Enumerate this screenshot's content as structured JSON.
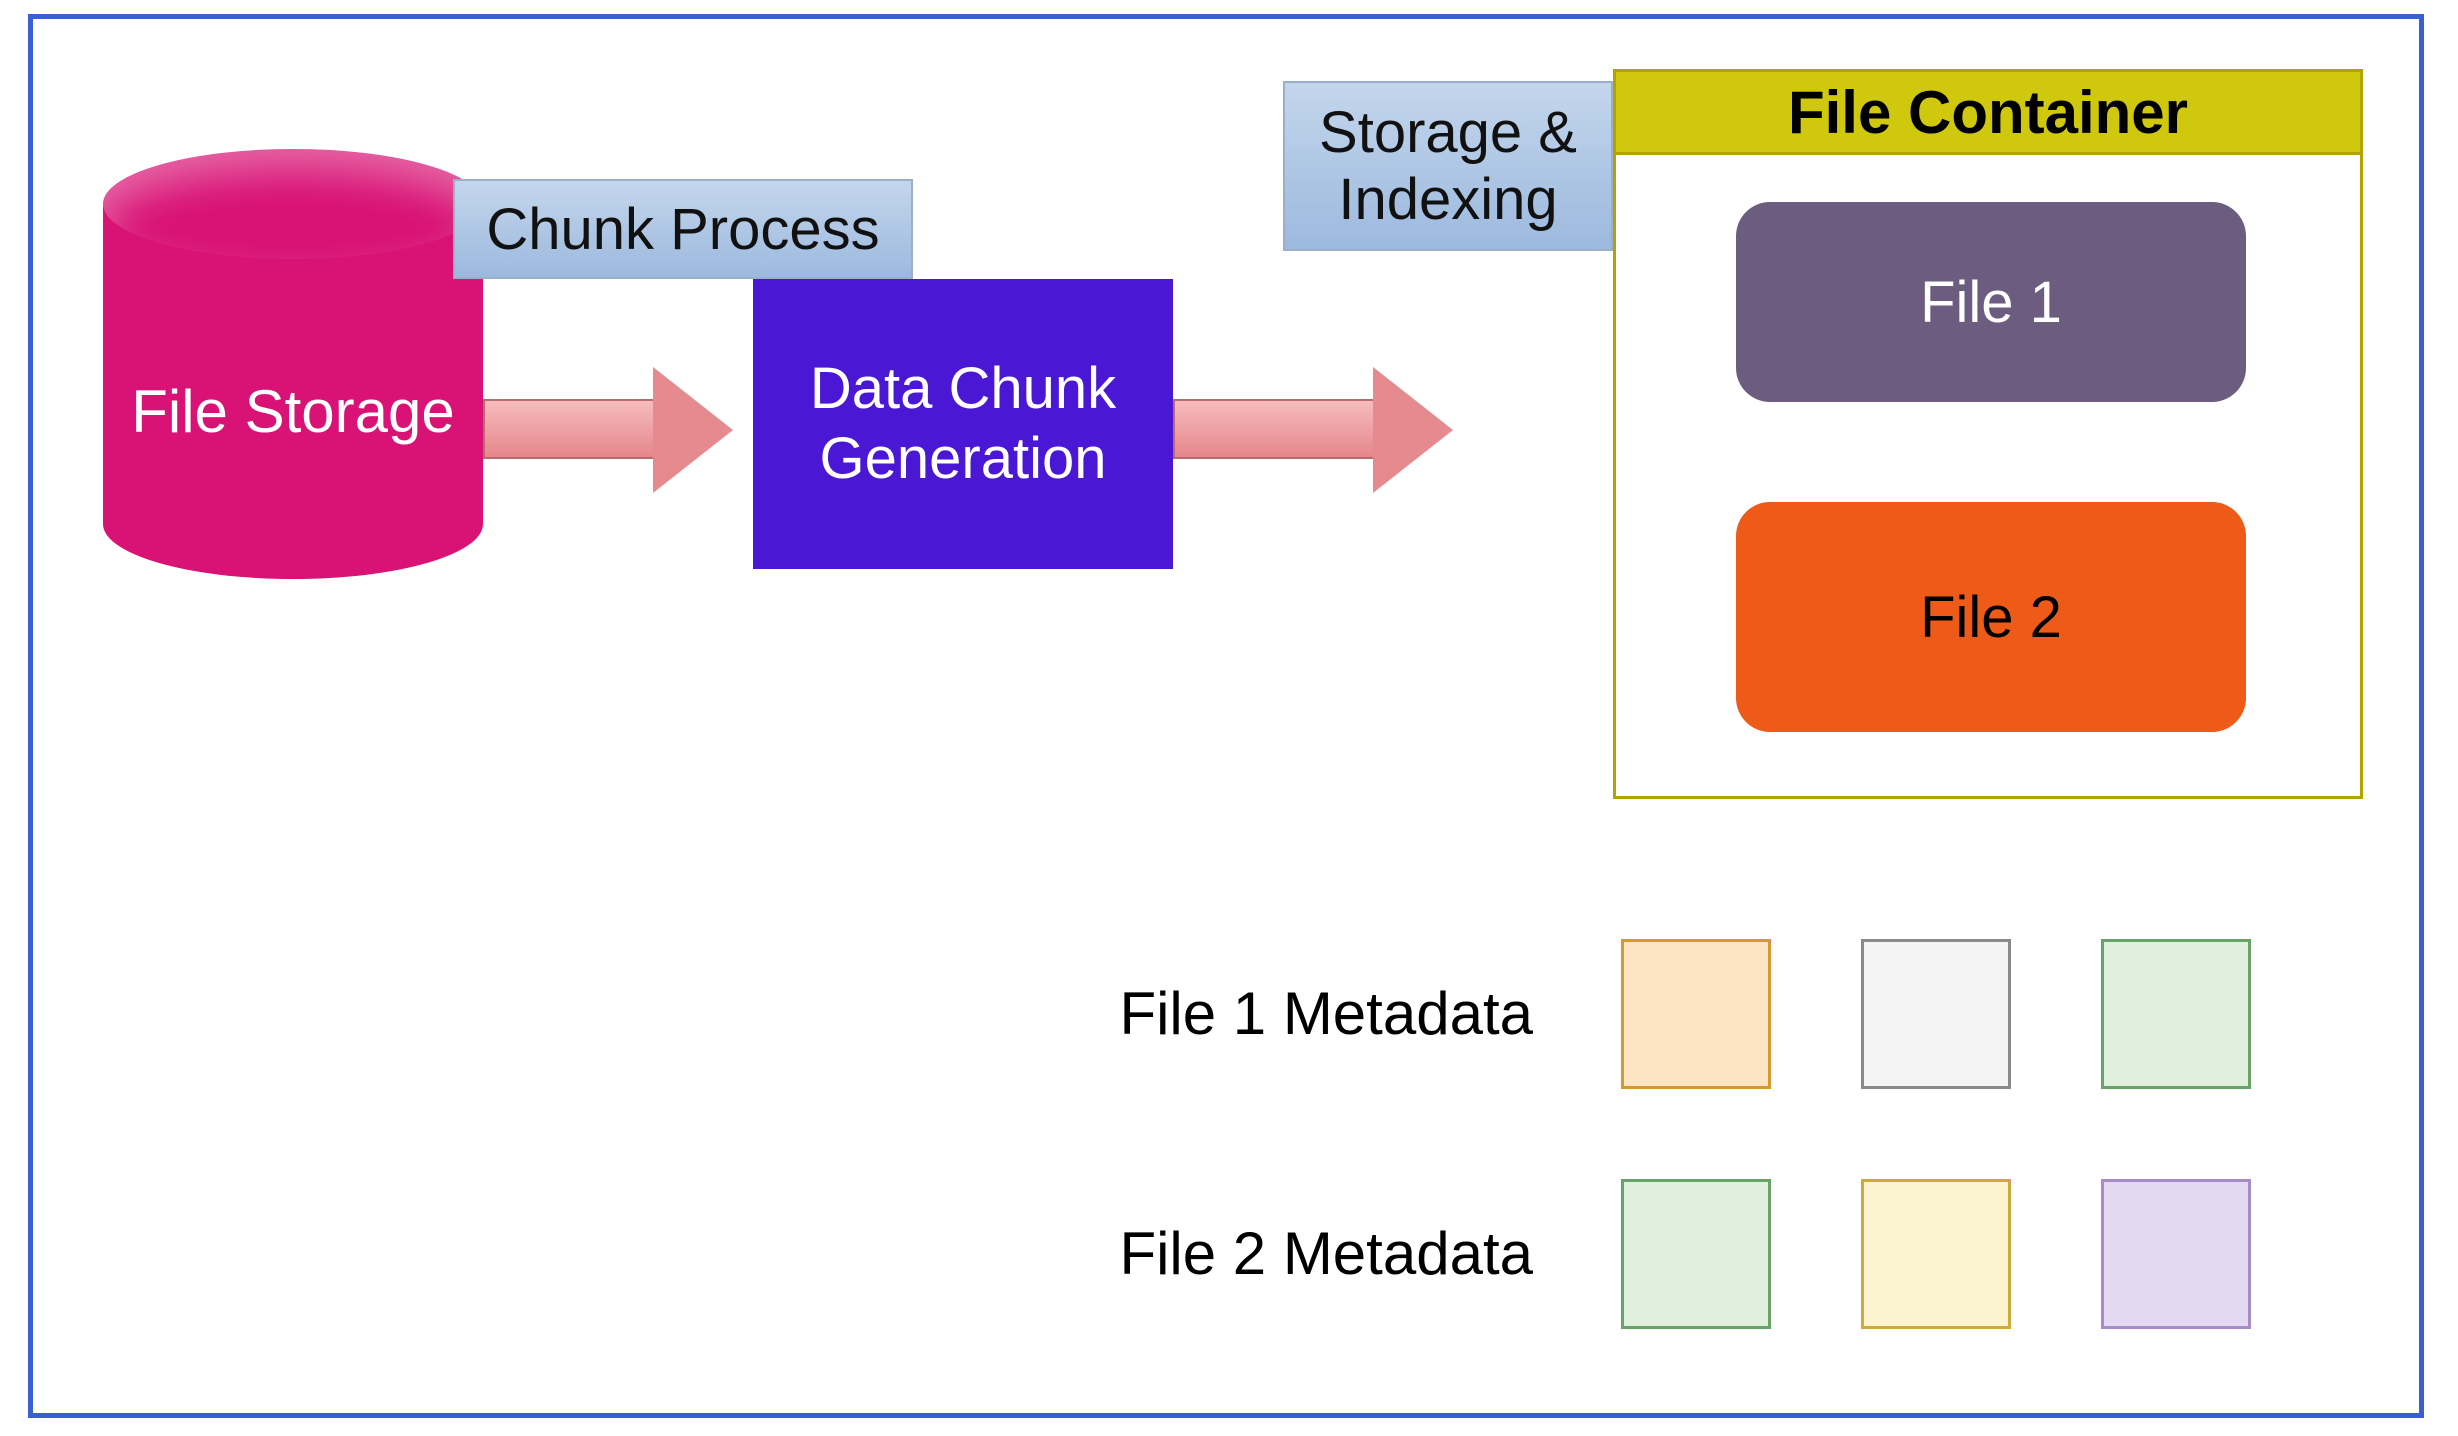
{
  "cylinder": {
    "label": "File Storage"
  },
  "labels": {
    "chunk_process": "Chunk Process",
    "storage_indexing": "Storage &\nIndexing"
  },
  "data_chunk": {
    "label": "Data Chunk\nGeneration"
  },
  "file_container": {
    "title": "File Container",
    "files": [
      {
        "label": "File 1"
      },
      {
        "label": "File 2"
      }
    ]
  },
  "metadata_rows": [
    {
      "label": "File 1 Metadata",
      "swatches": [
        {
          "fill": "#fde5c4",
          "border": "#d49a2f"
        },
        {
          "fill": "#f4f4f4",
          "border": "#8a8a8a"
        },
        {
          "fill": "#e0f0dd",
          "border": "#6aa36a"
        }
      ]
    },
    {
      "label": "File 2 Metadata",
      "swatches": [
        {
          "fill": "#e0f0dd",
          "border": "#6aa36a"
        },
        {
          "fill": "#fcf3cf",
          "border": "#cfa93a"
        },
        {
          "fill": "#e3d9f0",
          "border": "#a78cc8"
        }
      ]
    }
  ],
  "colors": {
    "frame_border": "#3a5fd0",
    "cylinder": "#d91275",
    "blue_box_top": "#c4d6ec",
    "blue_box_bottom": "#9cb9de",
    "arrow": "#e58b8f",
    "purple_box": "#4a17d4",
    "container_border": "#b3a300",
    "container_header": "#cfc80d",
    "file1": "#6c5d80",
    "file2": "#ee5a17"
  }
}
